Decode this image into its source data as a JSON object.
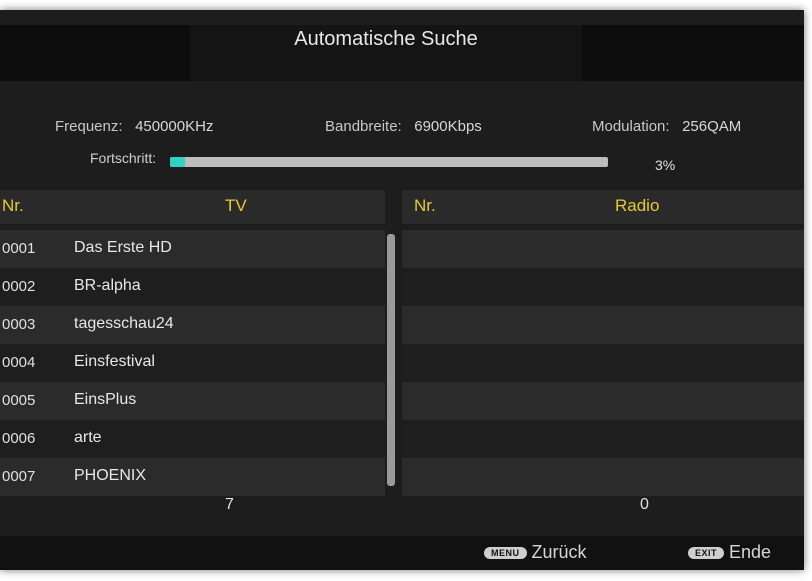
{
  "header": {
    "title": "Automatische Suche"
  },
  "info": {
    "frequency_label": "Frequenz:",
    "frequency_value": "450000KHz",
    "bandwidth_label": "Bandbreite:",
    "bandwidth_value": "6900Kbps",
    "modulation_label": "Modulation:",
    "modulation_value": "256QAM"
  },
  "progress": {
    "label": "Fortschritt:",
    "percent_text": "3%",
    "fraction": 0.03
  },
  "columns": {
    "tv_nr": "Nr.",
    "tv": "TV",
    "radio_nr": "Nr.",
    "radio": "Radio"
  },
  "tv_channels": [
    {
      "nr": "0001",
      "name": "Das Erste HD"
    },
    {
      "nr": "0002",
      "name": "BR-alpha"
    },
    {
      "nr": "0003",
      "name": "tagesschau24"
    },
    {
      "nr": "0004",
      "name": "Einsfestival"
    },
    {
      "nr": "0005",
      "name": "EinsPlus"
    },
    {
      "nr": "0006",
      "name": "arte"
    },
    {
      "nr": "0007",
      "name": "PHOENIX"
    }
  ],
  "radio_channels": [],
  "counts": {
    "tv": "7",
    "radio": "0"
  },
  "footer": {
    "back_key": "MENU",
    "back_label": "Zurück",
    "exit_key": "EXIT",
    "exit_label": "Ende"
  },
  "colors": {
    "accent_header": "#e7c83a",
    "progress_fill": "#2fd3c0"
  }
}
